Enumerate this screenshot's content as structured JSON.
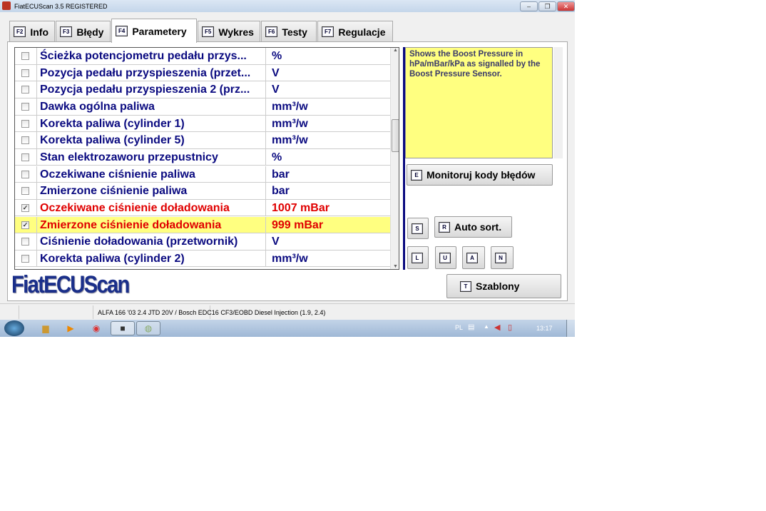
{
  "window": {
    "title": "FiatECUScan 3.5 REGISTERED",
    "controls": [
      "–",
      "❐",
      "✕"
    ]
  },
  "tabs": [
    {
      "key": "F2",
      "label": "Info"
    },
    {
      "key": "F3",
      "label": "Błędy"
    },
    {
      "key": "F4",
      "label": "Parametery",
      "active": true
    },
    {
      "key": "F5",
      "label": "Wykres"
    },
    {
      "key": "F6",
      "label": "Testy"
    },
    {
      "key": "F7",
      "label": "Regulacje"
    }
  ],
  "rows": [
    {
      "name": "Ścieżka potencjometru pedału przys...",
      "value": "%",
      "checked": false
    },
    {
      "name": "Pozycja pedału przyspieszenia (przet...",
      "value": "V",
      "checked": false
    },
    {
      "name": "Pozycja pedału przyspieszenia 2 (prz...",
      "value": "V",
      "checked": false
    },
    {
      "name": "Dawka ogólna paliwa",
      "value": "mm³/w",
      "checked": false
    },
    {
      "name": "Korekta paliwa (cylinder 1)",
      "value": "mm³/w",
      "checked": false
    },
    {
      "name": "Korekta paliwa (cylinder 5)",
      "value": "mm³/w",
      "checked": false
    },
    {
      "name": "Stan elektrozaworu przepustnicy",
      "value": "%",
      "checked": false
    },
    {
      "name": "Oczekiwane ciśnienie paliwa",
      "value": "bar",
      "checked": false
    },
    {
      "name": "Zmierzone ciśnienie paliwa",
      "value": "bar",
      "checked": false
    },
    {
      "name": "Oczekiwane ciśnienie doładowania",
      "value": "1007 mBar",
      "checked": true
    },
    {
      "name": "Zmierzone ciśnienie doładowania",
      "value": "999 mBar",
      "checked": true,
      "selected": true
    },
    {
      "name": "Ciśnienie doładowania (przetwornik)",
      "value": "V",
      "checked": false
    },
    {
      "name": "Korekta paliwa (cylinder 2)",
      "value": "mm³/w",
      "checked": false
    }
  ],
  "help_text": "Shows the Boost Pressure in hPa/mBar/kPa as signalled by the Boost Pressure Sensor.",
  "buttons": {
    "monitor": {
      "key": "E",
      "label": "Monitoruj kody błędów"
    },
    "s": {
      "key": "S"
    },
    "autosort": {
      "key": "R",
      "label": "Auto sort."
    },
    "l": {
      "key": "L"
    },
    "u": {
      "key": "U"
    },
    "a": {
      "key": "A"
    },
    "n": {
      "key": "N"
    },
    "templates": {
      "key": "T",
      "label": "Szablony"
    }
  },
  "logo": "FiatECUScan",
  "status": {
    "vehicle": "ALFA 166 '03 2.4 JTD 20V / Bosch EDC16 CF3/EOBD Diesel Injection (1.9, 2.4)"
  },
  "taskbar": {
    "lang": "PL",
    "time": "13:17"
  },
  "colors": {
    "text_blue": "#0a0a80",
    "active_red": "#e00000",
    "highlight": "#ffff80"
  }
}
